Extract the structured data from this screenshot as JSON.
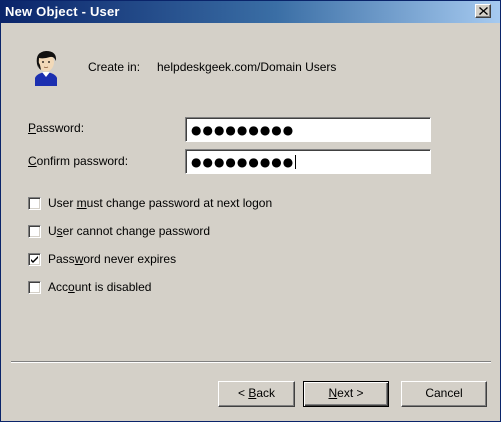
{
  "window": {
    "title": "New Object - User",
    "close_icon": "close-icon"
  },
  "header": {
    "icon": "user-icon",
    "create_in_label": "Create in:",
    "create_in_path": "helpdeskgeek.com/Domain Users"
  },
  "form": {
    "password": {
      "label_mnemonic": "P",
      "label_rest": "assword:",
      "masked_value": "●●●●●●●●●"
    },
    "confirm_password": {
      "label_mnemonic": "C",
      "label_rest": "onfirm password:",
      "masked_value": "●●●●●●●●●"
    }
  },
  "options": [
    {
      "pre": "User ",
      "mnemonic": "m",
      "post": "ust change password at next logon",
      "checked": false
    },
    {
      "pre": "U",
      "mnemonic": "s",
      "post": "er cannot change password",
      "checked": false
    },
    {
      "pre": "Pass",
      "mnemonic": "w",
      "post": "ord never expires",
      "checked": true
    },
    {
      "pre": "Acc",
      "mnemonic": "o",
      "post": "unt is disabled",
      "checked": false
    }
  ],
  "buttons": {
    "back": {
      "prefix": "< ",
      "mnemonic": "B",
      "rest": "ack"
    },
    "next": {
      "mnemonic": "N",
      "rest": "ext >"
    },
    "cancel": "Cancel"
  }
}
